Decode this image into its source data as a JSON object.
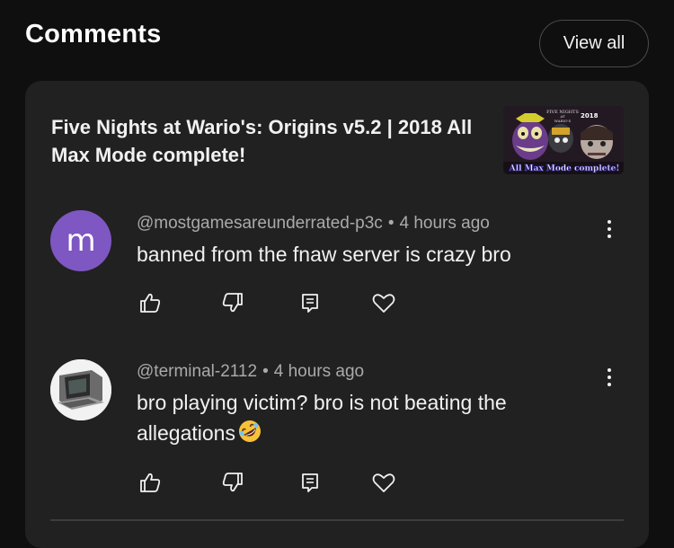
{
  "header": {
    "title": "Comments",
    "view_all_label": "View all"
  },
  "video": {
    "title": "Five Nights at Wario's: Origins v5.2 | 2018 All Max Mode complete!",
    "thumbnail_overlay": "All Max Mode complete!",
    "thumbnail_year": "2018"
  },
  "comments": [
    {
      "avatar_letter": "m",
      "avatar_color": "#7e57c2",
      "author": "@mostgamesareunderrated-p3c",
      "time": "4 hours ago",
      "text": "banned from the fnaw server is crazy bro"
    },
    {
      "avatar_letter": "",
      "author": "@terminal-2112",
      "time": "4 hours ago",
      "text": "bro playing victim? bro is not beating the allegations",
      "emoji": "rolling-on-floor-laughing-icon"
    }
  ],
  "colors": {
    "background": "#0f0f0f",
    "card": "#212121",
    "muted_text": "#aaaaaa",
    "text": "#f1f1f1"
  },
  "separator": "•"
}
